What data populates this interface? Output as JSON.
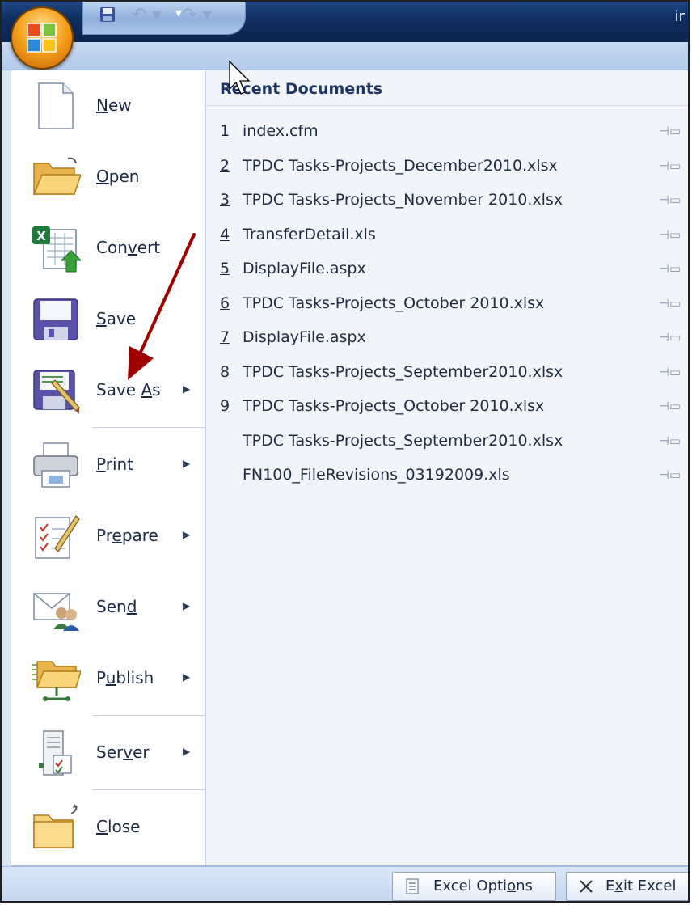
{
  "window": {
    "title_fragment": "ir"
  },
  "quick_access": {
    "save_icon": "save-icon",
    "undo_icon": "undo-icon",
    "redo_icon": "redo-icon",
    "customize_icon": "customize-toolbar-icon"
  },
  "office_button": {
    "icon": "office-logo-icon"
  },
  "commands": [
    {
      "pre": "",
      "key": "N",
      "post": "ew",
      "has_submenu": false,
      "icon": "new-document-icon"
    },
    {
      "pre": "",
      "key": "O",
      "post": "pen",
      "has_submenu": false,
      "icon": "open-folder-icon"
    },
    {
      "pre": "Con",
      "key": "v",
      "post": "ert",
      "has_submenu": false,
      "icon": "convert-icon"
    },
    {
      "pre": "",
      "key": "S",
      "post": "ave",
      "has_submenu": false,
      "icon": "save-icon"
    },
    {
      "pre": "Save ",
      "key": "A",
      "post": "s",
      "has_submenu": true,
      "icon": "save-as-icon"
    },
    {
      "pre": "",
      "key": "P",
      "post": "rint",
      "has_submenu": true,
      "icon": "print-icon"
    },
    {
      "pre": "Pr",
      "key": "e",
      "post": "pare",
      "has_submenu": true,
      "icon": "prepare-icon"
    },
    {
      "pre": "Sen",
      "key": "d",
      "post": "",
      "has_submenu": true,
      "icon": "send-icon"
    },
    {
      "pre": "P",
      "key": "u",
      "post": "blish",
      "has_submenu": true,
      "icon": "publish-icon"
    },
    {
      "pre": "Ser",
      "key": "v",
      "post": "er",
      "has_submenu": true,
      "icon": "server-icon"
    },
    {
      "pre": "",
      "key": "C",
      "post": "lose",
      "has_submenu": false,
      "icon": "close-folder-icon"
    }
  ],
  "recent": {
    "title": "Recent Documents",
    "items": [
      {
        "num": "1",
        "name": "index.cfm"
      },
      {
        "num": "2",
        "name": "TPDC Tasks-Projects_December2010.xlsx"
      },
      {
        "num": "3",
        "name": "TPDC Tasks-Projects_November 2010.xlsx"
      },
      {
        "num": "4",
        "name": "TransferDetail.xls"
      },
      {
        "num": "5",
        "name": "DisplayFile.aspx"
      },
      {
        "num": "6",
        "name": "TPDC Tasks-Projects_October 2010.xlsx"
      },
      {
        "num": "7",
        "name": "DisplayFile.aspx"
      },
      {
        "num": "8",
        "name": "TPDC Tasks-Projects_September2010.xlsx"
      },
      {
        "num": "9",
        "name": "TPDC Tasks-Projects_October 2010.xlsx"
      },
      {
        "num": "",
        "name": "TPDC Tasks-Projects_September2010.xlsx"
      },
      {
        "num": "",
        "name": "FN100_FileRevisions_03192009.xls"
      }
    ],
    "pin_icon": "pin-icon"
  },
  "bottom": {
    "options": {
      "pre": "Excel Opti",
      "key": "o",
      "post": "ns",
      "icon": "options-icon"
    },
    "exit": {
      "pre": "E",
      "key": "x",
      "post": "it Excel",
      "icon": "close-x-icon"
    }
  },
  "annotation": {
    "arrow_color": "#c00000",
    "arrow_icon": "red-arrow-annotation"
  }
}
